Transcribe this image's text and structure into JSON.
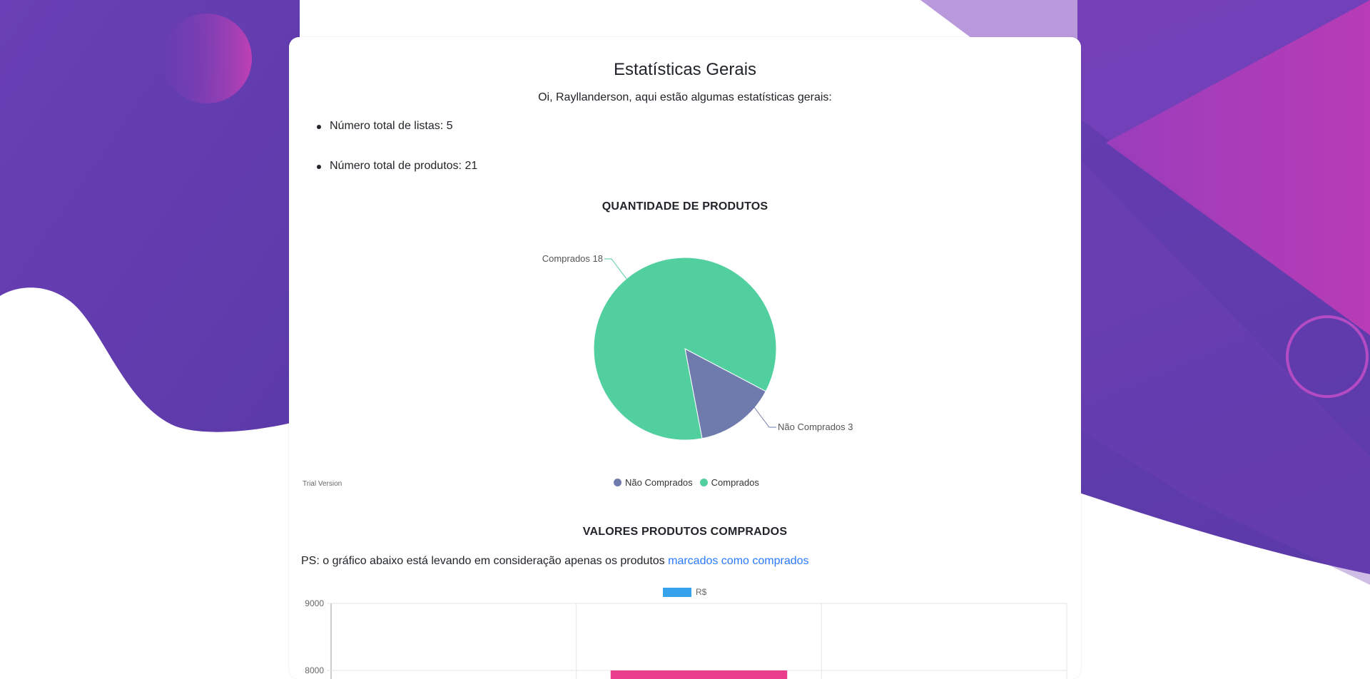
{
  "header": {
    "title": "Estatísticas Gerais",
    "greeting": "Oi, Rayllanderson, aqui estão algumas estatísticas gerais:"
  },
  "stats": [
    {
      "label": "Número total de listas: 5"
    },
    {
      "label": "Número total de produtos: 21"
    }
  ],
  "pie_section": {
    "title": "QUANTIDADE DE PRODUTOS",
    "trial_text": "Trial Version"
  },
  "bar_section": {
    "title": "VALORES PRODUTOS COMPRADOS",
    "note_prefix": "PS: o gráfico abaixo está levando em consideração apenas os produtos ",
    "note_link": "marcados como comprados"
  },
  "colors": {
    "accent_purple": "#6a3fb5",
    "pink": "#b53bb8",
    "pie_green": "#52cf9f",
    "pie_blue": "#6f7aad",
    "bar_pink": "#e83e8c",
    "legend_blue": "#36a2eb",
    "link": "#2979ff"
  },
  "chart_data": [
    {
      "type": "pie",
      "title": "QUANTIDADE DE PRODUTOS",
      "categories": [
        "Não Comprados",
        "Comprados"
      ],
      "values": [
        3,
        18
      ],
      "data_labels": [
        "Não Comprados 3",
        "Comprados 18"
      ],
      "legend": [
        "Não Comprados",
        "Comprados"
      ],
      "legend_position": "bottom"
    },
    {
      "type": "bar",
      "title": "VALORES PRODUTOS COMPRADOS",
      "series": [
        {
          "name": "R$",
          "values": [
            null,
            8000,
            null
          ]
        }
      ],
      "y_ticks": [
        "9000",
        "8000"
      ],
      "ylim": [
        0,
        9000
      ],
      "grid": true,
      "legend_position": "top"
    }
  ]
}
